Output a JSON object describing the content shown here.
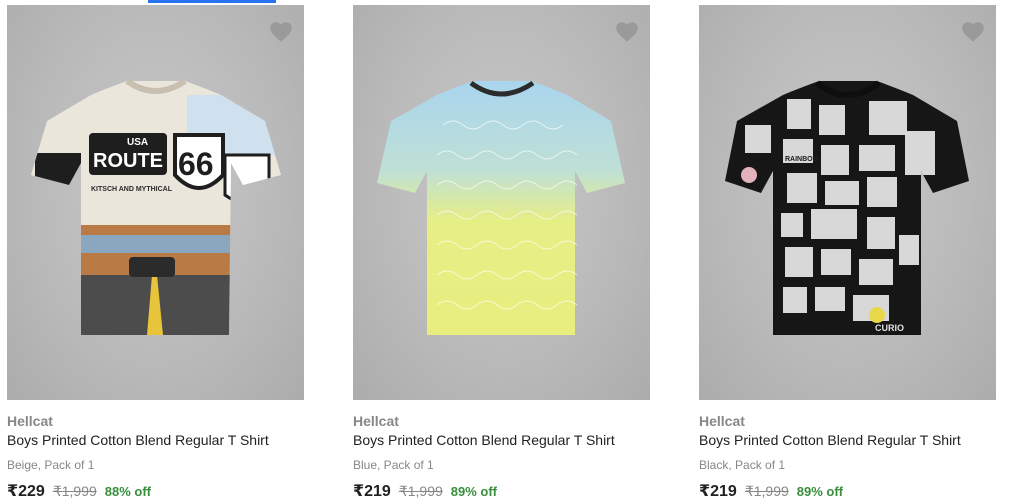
{
  "colors": {
    "accent": "#2874f0",
    "discount": "#388e3c",
    "muted": "#878787",
    "text": "#212121"
  },
  "products": [
    {
      "brand": "Hellcat",
      "title": "Boys Printed Cotton Blend Regular T Shirt",
      "variant": "Beige, Pack of 1",
      "price": "₹229",
      "mrp": "₹1,999",
      "discount": "88% off",
      "wishlist_icon": "heart-icon",
      "print_text": [
        "USA",
        "ROUTE",
        "66",
        "KITSCH AND MYTHICAL"
      ]
    },
    {
      "brand": "Hellcat",
      "title": "Boys Printed Cotton Blend Regular T Shirt",
      "variant": "Blue, Pack of 1",
      "price": "₹219",
      "mrp": "₹1,999",
      "discount": "89% off",
      "wishlist_icon": "heart-icon"
    },
    {
      "brand": "Hellcat",
      "title": "Boys Printed Cotton Blend Regular T Shirt",
      "variant": "Black, Pack of 1",
      "price": "₹219",
      "mrp": "₹1,999",
      "discount": "89% off",
      "wishlist_icon": "heart-icon",
      "print_text": [
        "RAINBOW",
        "CURIO"
      ]
    }
  ]
}
